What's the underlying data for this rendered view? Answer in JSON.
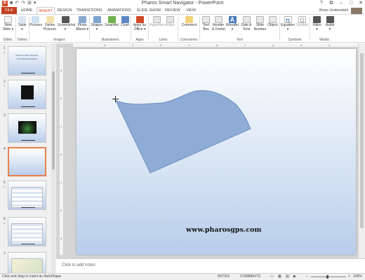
{
  "titlebar": {
    "app_icon": "P",
    "title": "Pharos Smart Navigator - PowerPoint",
    "qat": [
      "■",
      "↶",
      "↷",
      "⊞",
      "▾"
    ]
  },
  "window": {
    "help": "?",
    "restore": "⧉",
    "minimize": "–",
    "maximize": "□",
    "close": "✕"
  },
  "tabs": [
    "FILE",
    "HOME",
    "INSERT",
    "DESIGN",
    "TRANSITIONS",
    "ANIMATIONS",
    "SLIDE SHOW",
    "REVIEW",
    "VIEW"
  ],
  "user": "Brian Undendahl",
  "ribbon": {
    "buttons": [
      {
        "label": "New\nSlide ▾",
        "icon": "new-slide-icon",
        "color": "#f2f2f2",
        "disabled": false
      },
      {
        "label": "Table\n▾",
        "icon": "table-icon",
        "color": "#dbe6f4",
        "disabled": false
      },
      {
        "label": "Pictures",
        "icon": "pictures-icon",
        "color": "#cfe0f1",
        "disabled": false
      },
      {
        "label": "Online\nPictures",
        "icon": "online-pictures-icon",
        "color": "#f3e2b0",
        "disabled": false
      },
      {
        "label": "Screenshot\n▾",
        "icon": "screenshot-icon",
        "color": "#555555",
        "disabled": false
      },
      {
        "label": "Photo\nAlbum ▾",
        "icon": "photo-album-icon",
        "color": "#8aa9cf",
        "disabled": false
      },
      {
        "label": "Shapes\n▾",
        "icon": "shapes-icon",
        "color": "#7fa2cf",
        "disabled": false
      },
      {
        "label": "SmartArt",
        "icon": "smartart-icon",
        "color": "#6fb34c",
        "disabled": false
      },
      {
        "label": "Chart",
        "icon": "chart-icon",
        "color": "#5b87c6",
        "disabled": false
      },
      {
        "label": "Apps for\nOffice ▾",
        "icon": "apps-for-office-icon",
        "color": "#d04a2a",
        "disabled": false
      },
      {
        "label": "Hyperlink",
        "icon": "hyperlink-icon",
        "color": "#e4e4e4",
        "disabled": true
      },
      {
        "label": "Action",
        "icon": "action-icon",
        "color": "#e4e4e4",
        "disabled": true
      },
      {
        "label": "Comment",
        "icon": "comment-icon",
        "color": "#f2d37a",
        "disabled": false
      },
      {
        "label": "Text\nBox",
        "icon": "text-box-icon",
        "color": "#e8e8e8",
        "disabled": false
      },
      {
        "label": "Header\n& Footer",
        "icon": "header-footer-icon",
        "color": "#e8e8e8",
        "disabled": false
      },
      {
        "label": "WordArt\n▾",
        "icon": "wordart-icon",
        "color": "#4a78bd",
        "disabled": false
      },
      {
        "label": "Date &\nTime",
        "icon": "date-time-icon",
        "color": "#e8e8e8",
        "disabled": false
      },
      {
        "label": "Slide\nNumber",
        "icon": "slide-number-icon",
        "color": "#e8e8e8",
        "disabled": false
      },
      {
        "label": "Object",
        "icon": "object-icon",
        "color": "#e8e8e8",
        "disabled": false
      },
      {
        "label": "Equation\n▾",
        "icon": "equation-icon",
        "color": "#ffffff",
        "disabled": false
      },
      {
        "label": "Symbol",
        "icon": "symbol-icon",
        "color": "#ffffff",
        "disabled": true
      },
      {
        "label": "Video\n▾",
        "icon": "video-icon",
        "color": "#555555",
        "disabled": false
      },
      {
        "label": "Audio\n▾",
        "icon": "audio-icon",
        "color": "#555555",
        "disabled": false
      }
    ],
    "groups": [
      "Slides",
      "Tables",
      "Images",
      "Illustrations",
      "Apps",
      "Links",
      "Comments",
      "Text",
      "Symbols",
      "Media"
    ],
    "equation_glyph": "π",
    "symbol_glyph": "Ω",
    "wordart_glyph": "A"
  },
  "slides": [
    {
      "num": "1",
      "star": "*",
      "title": "Pharos Smart Navigator",
      "subtitle": "PS Headline Data Experts",
      "kind": "title"
    },
    {
      "num": "2",
      "star": "*",
      "kind": "dark-square"
    },
    {
      "num": "3",
      "star": "",
      "kind": "dark-wide"
    },
    {
      "num": "4",
      "star": "",
      "kind": "blank",
      "selected": true
    },
    {
      "num": "5",
      "star": "*",
      "kind": "table"
    },
    {
      "num": "6",
      "star": "*",
      "kind": "table"
    },
    {
      "num": "7",
      "star": "",
      "kind": "map"
    }
  ],
  "ruler": {
    "top": [
      "4",
      "3",
      "2",
      "1",
      "0",
      "1",
      "2",
      "3",
      "4"
    ],
    "left": [
      "3",
      "2",
      "1",
      "0",
      "1",
      "2",
      "3"
    ]
  },
  "slide": {
    "url_text": "www.pharosgps.com",
    "shape_fill": "#8eacd6",
    "shape_stroke": "#6f8fbf"
  },
  "notes": {
    "placeholder": "Click to add notes"
  },
  "status": {
    "message": "Click and drag to insert an AutoShape.",
    "notes": "NOTES",
    "comments": "COMMENTS",
    "zoom_minus": "–",
    "zoom_plus": "+",
    "zoom": "100%"
  }
}
